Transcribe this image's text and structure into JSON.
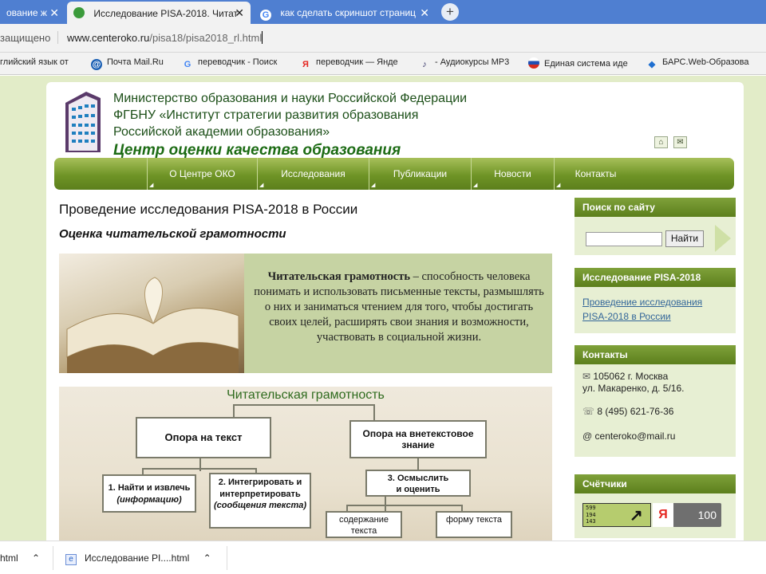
{
  "browser": {
    "tabs": [
      {
        "label": "ование ж",
        "active": false
      },
      {
        "label": "Исследование PISA-2018. Читат",
        "active": true
      },
      {
        "label": "как сделать скриншот страниц",
        "active": false
      }
    ],
    "new_tab": "+",
    "address": {
      "security": "защищено",
      "url_host": "www.centeroko.ru",
      "url_path": "/pisa18/pisa2018_rl.html"
    },
    "bookmarks": [
      {
        "label": "глийский язык от",
        "icon": "globe-icon"
      },
      {
        "label": "Почта Mail.Ru",
        "icon": "mailru-icon"
      },
      {
        "label": "переводчик - Поиск",
        "icon": "google-icon"
      },
      {
        "label": "переводчик — Янде",
        "icon": "yandex-icon"
      },
      {
        "label": "- Аудиокурсы МР3",
        "icon": "audio-icon"
      },
      {
        "label": "Единая система иде",
        "icon": "russia-icon"
      },
      {
        "label": "БАРС.Web-Образова",
        "icon": "bars-icon"
      }
    ]
  },
  "site": {
    "org_lines": [
      "Министерство образования и науки Российской Федерации",
      "ФГБНУ «Институт стратегии развития образования",
      "Российской академии образования»"
    ],
    "center_name": "Центр оценки качества образования",
    "nav": [
      "О Центре ОКО",
      "Исследования",
      "Публикации",
      "Новости",
      "Контакты"
    ]
  },
  "main": {
    "title": "Проведение исследования PISA-2018 в России",
    "subtitle": "Оценка читательской грамотности",
    "banner": {
      "term": "Читательская грамотность",
      "definition": " – способность человека понимать и использовать письменные тексты, размышлять о них и заниматься чтением для того, чтобы достигать своих целей, расширять свои знания и возможности, участвовать в социальной жизни."
    },
    "diagram": {
      "title": "Читательская грамотность",
      "left_head": "Опора на текст",
      "right_head": "Опора на внетекстовое знание",
      "box1_a": "1. Найти и извлечь",
      "box1_b": "(информацию)",
      "box2_a": "2. Интегрировать и интерпретировать",
      "box2_b": "(сообщения текста)",
      "box3_a": "3. Осмыслить",
      "box3_b": "и оценить",
      "leaf1": "содержание текста",
      "leaf2": "форму текста"
    }
  },
  "sidebar": {
    "search": {
      "title": "Поиск по сайту",
      "placeholder": "",
      "button": "Найти"
    },
    "pisa": {
      "title": "Исследование PISA-2018",
      "link": "Проведение исследования PISA-2018 в России"
    },
    "contacts": {
      "title": "Контакты",
      "address1": "105062 г. Москва",
      "address2": "ул. Макаренко, д. 5/16.",
      "phone": "8 (495) 621-76-36",
      "email": "centeroko@mail.ru"
    },
    "counters": {
      "title": "Счётчики",
      "li_lines": [
        "599",
        "194",
        "143"
      ],
      "ya_value": "100"
    }
  },
  "taskbar": [
    {
      "label": "html"
    },
    {
      "label": "Исследование PI....html"
    }
  ],
  "colors": {
    "nav_green": "#6f9426",
    "title_green": "#1c6b14",
    "tab_blue": "#4f7fd1"
  }
}
